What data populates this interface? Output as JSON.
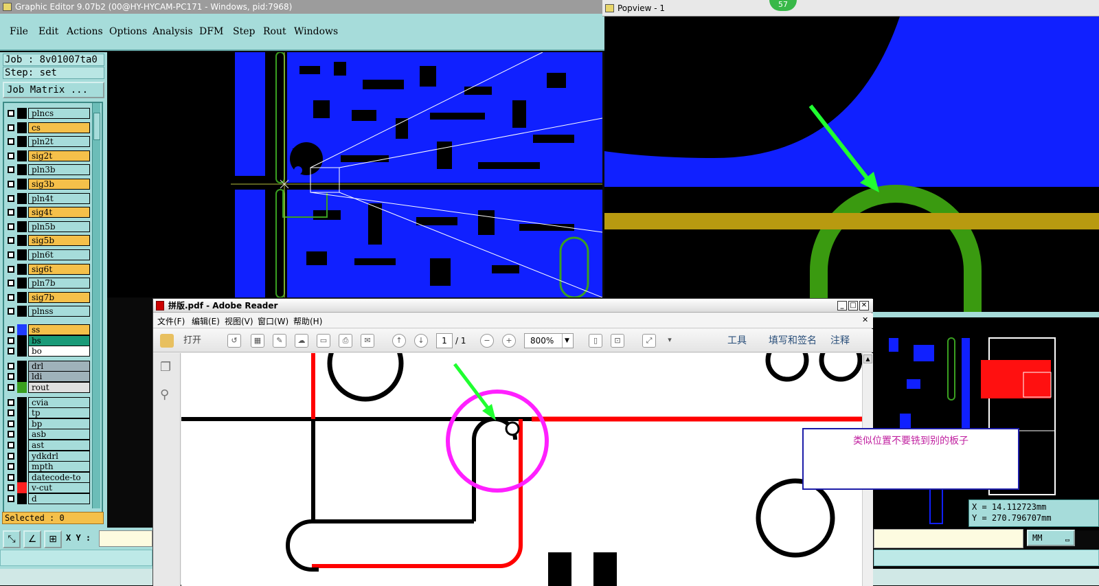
{
  "graphic_editor": {
    "title": "Graphic Editor 9.07b2 (00@HY-HYCAM-PC171 - Windows, pid:7968)",
    "menu": [
      "File",
      "Edit",
      "Actions",
      "Options",
      "Analysis",
      "DFM",
      "Step",
      "Rout",
      "Windows"
    ],
    "job_label": "Job : 8v01007ta0",
    "step_label": "Step: set",
    "job_matrix_button": "Job Matrix ...",
    "layers": [
      {
        "name": "plncs",
        "color": "#a6dcda"
      },
      {
        "name": "cs",
        "color": "#f5c04a"
      },
      {
        "name": "pln2t",
        "color": "#a6dcda"
      },
      {
        "name": "sig2t",
        "color": "#f5c04a"
      },
      {
        "name": "pln3b",
        "color": "#a6dcda"
      },
      {
        "name": "sig3b",
        "color": "#f5c04a"
      },
      {
        "name": "pln4t",
        "color": "#a6dcda"
      },
      {
        "name": "sig4t",
        "color": "#f5c04a"
      },
      {
        "name": "pln5b",
        "color": "#a6dcda"
      },
      {
        "name": "sig5b",
        "color": "#f5c04a"
      },
      {
        "name": "pln6t",
        "color": "#a6dcda"
      },
      {
        "name": "sig6t",
        "color": "#f5c04a"
      },
      {
        "name": "pln7b",
        "color": "#a6dcda"
      },
      {
        "name": "sig7b",
        "color": "#f5c04a"
      },
      {
        "name": "plnss",
        "color": "#a6dcda"
      },
      {
        "name": "ss",
        "color": "#f5c04a",
        "swatch": "#1f3cff"
      },
      {
        "name": "bs",
        "color": "#1a9a78"
      },
      {
        "name": "bo",
        "color": "#ffffff"
      },
      {
        "name": "drl",
        "color": "#9fb2ba"
      },
      {
        "name": "ldi",
        "color": "#9fb2ba"
      },
      {
        "name": "rout",
        "color": "#e0e0e0",
        "swatch": "#3aa020"
      },
      {
        "name": "cvia",
        "color": "#a6dcda"
      },
      {
        "name": "tp",
        "color": "#a6dcda"
      },
      {
        "name": "bp",
        "color": "#a6dcda"
      },
      {
        "name": "asb",
        "color": "#a6dcda"
      },
      {
        "name": "ast",
        "color": "#a6dcda"
      },
      {
        "name": "ydkdrl",
        "color": "#a6dcda"
      },
      {
        "name": "mpth",
        "color": "#a6dcda"
      },
      {
        "name": "datecode-to",
        "color": "#a6dcda"
      },
      {
        "name": "v-cut",
        "color": "#a6dcda",
        "swatch": "#ff2020"
      },
      {
        "name": "d",
        "color": "#a6dcda"
      }
    ],
    "selected_label": "Selected : 0",
    "xy_label": "X Y :"
  },
  "popview": {
    "title": "Popview - 1",
    "badge": "57",
    "coord_x": "X = 14.112723mm",
    "coord_y": "Y = 270.796707mm",
    "units": "MM"
  },
  "adobe_reader": {
    "title": "拼版.pdf - Adobe Reader",
    "menu": [
      "文件(F)",
      "编辑(E)",
      "视图(V)",
      "窗口(W)",
      "帮助(H)"
    ],
    "open_label": "打开",
    "page_current": "1",
    "page_total": "/ 1",
    "zoom": "800%",
    "right_tools": [
      "工具",
      "填写和签名",
      "注释"
    ]
  },
  "note": {
    "text": "类似位置不要铣到别的板子"
  },
  "colors": {
    "accent": "#a6dcda",
    "pcb_copper": "#1020ff",
    "rout": "#3aa020",
    "highlight_circle": "#ff20ff",
    "arrow": "#20ff30"
  }
}
